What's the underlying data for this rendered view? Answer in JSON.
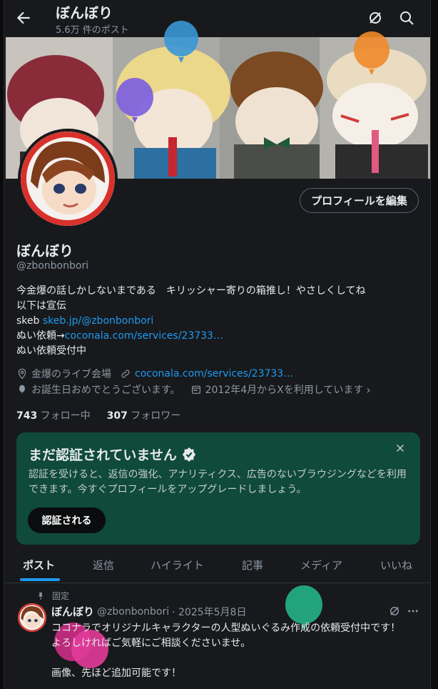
{
  "header": {
    "title": "ぼんぼり",
    "post_count": "5.6万 件のポスト"
  },
  "profile": {
    "edit_button": "プロフィールを編集",
    "name": "ぼんぼり",
    "handle": "@zbonbonbori",
    "bio_line1": "今金爆の話しかしないまである　キリッシャー寄りの箱推し！やさしくしてね",
    "bio_line2": "以下は宣伝",
    "bio_skeb_label": "skeb ",
    "bio_skeb_link": "skeb.jp/@zbonbonbori",
    "bio_nui_label": "ぬい依頼→",
    "bio_nui_link": "coconala.com/services/23733…",
    "bio_line5": "ぬい依頼受付中",
    "location": "金爆のライブ会場",
    "website": "coconala.com/services/23733…",
    "birthday": "お誕生日おめでとうございます。",
    "joined": "2012年4月からXを利用しています",
    "following_count": "743",
    "following_label": " フォロー中",
    "followers_count": "307",
    "followers_label": " フォロワー"
  },
  "verify_card": {
    "title": "まだ認証されていません",
    "body": "認証を受けると、返信の強化、アナリティクス、広告のないブラウジングなどを利用できます。今すぐプロフィールをアップグレードしましょう。",
    "button": "認証される"
  },
  "tabs": [
    "ポスト",
    "返信",
    "ハイライト",
    "記事",
    "メディア",
    "いいね"
  ],
  "post": {
    "pinned_label": "固定",
    "author_name": "ぼんぼり",
    "author_handle": "@zbonbonbori",
    "date": "· 2025年5月8日",
    "text_line1": "ココナラでオリジナルキャラクターの人型ぬいぐるみ作成の依頼受付中です！",
    "text_line2": "よろしければご気軽にご相談くださいませ。",
    "text_line3": "画像、先ほど追加可能です！"
  },
  "colors": {
    "accent": "#1d9bf0",
    "card_bg": "#0f4a3a",
    "page_bg": "#18191c"
  },
  "icons": [
    "back-arrow-icon",
    "grok-icon",
    "search-icon",
    "location-icon",
    "link-icon",
    "balloon-icon",
    "calendar-icon",
    "verified-badge-icon",
    "close-icon",
    "pin-icon",
    "more-icon"
  ]
}
